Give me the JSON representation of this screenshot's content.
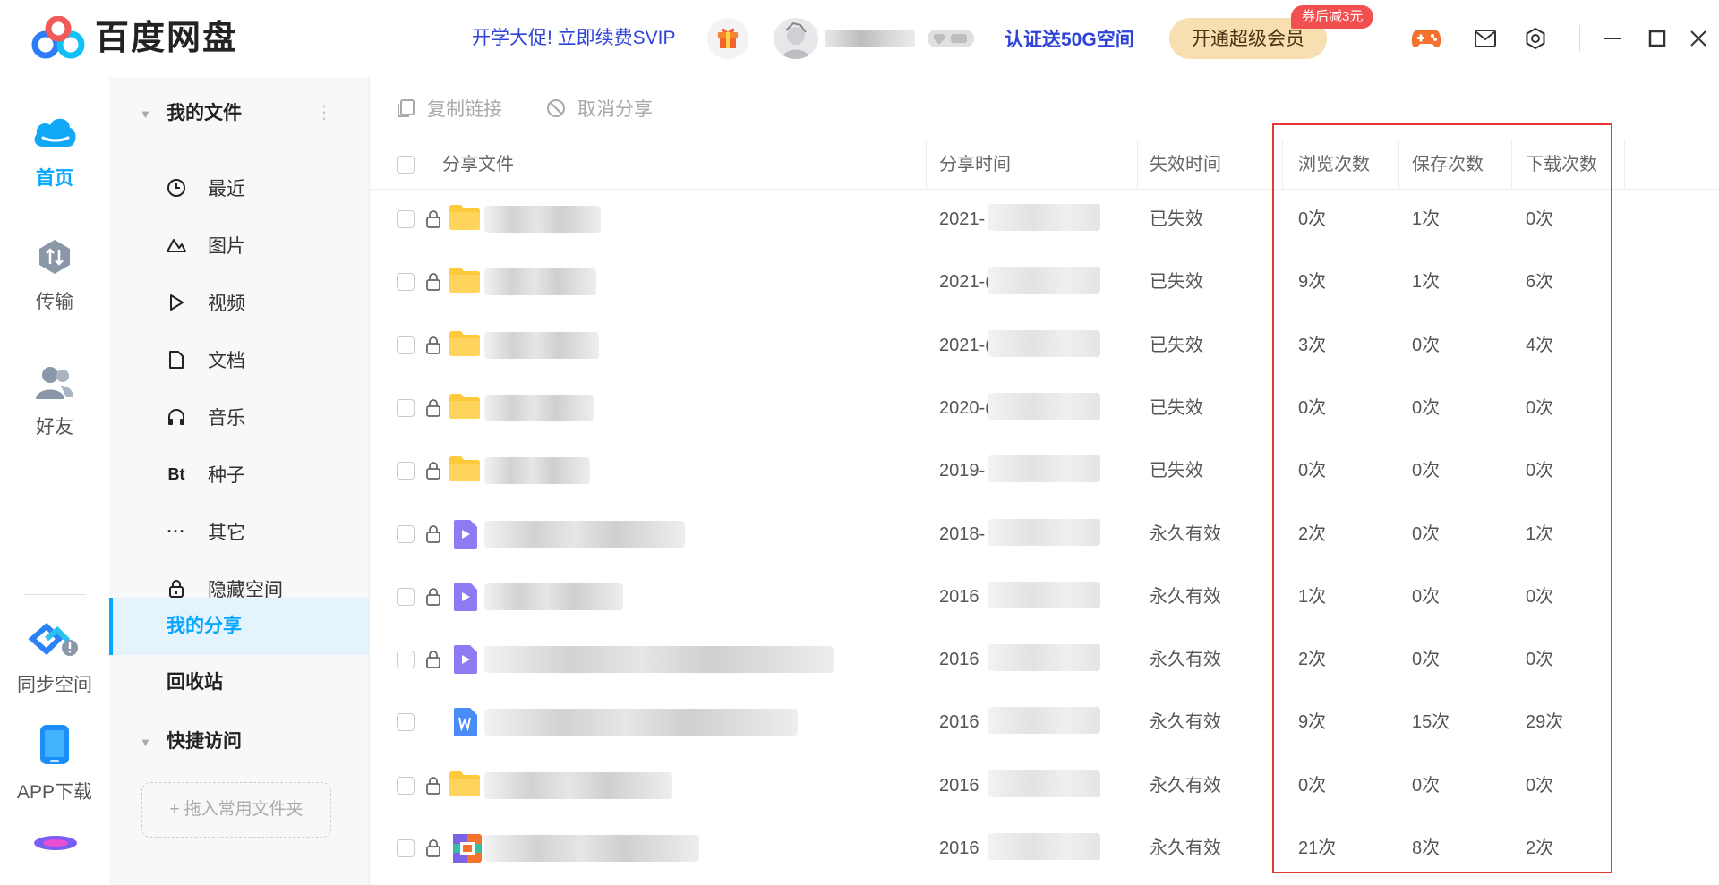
{
  "app": {
    "brand": "百度网盘",
    "promo_text": "开学大促! 立即续费SVIP",
    "verify_text": "认证送50G空间",
    "super_vip_button": "开通超级会员",
    "coupon_badge": "券后减3元"
  },
  "leftnav": {
    "items": [
      {
        "label": "首页",
        "icon": "cloud-icon",
        "active": true
      },
      {
        "label": "传输",
        "icon": "transfer-icon",
        "active": false
      },
      {
        "label": "好友",
        "icon": "friends-icon",
        "active": false
      },
      {
        "label": "同步空间",
        "icon": "sync-space-icon",
        "active": false
      },
      {
        "label": "APP下载",
        "icon": "phone-icon",
        "active": false
      }
    ]
  },
  "sidepanel": {
    "my_files": "我的文件",
    "items": [
      {
        "label": "最近",
        "icon": "clock-icon"
      },
      {
        "label": "图片",
        "icon": "image-icon"
      },
      {
        "label": "视频",
        "icon": "play-icon"
      },
      {
        "label": "文档",
        "icon": "document-icon"
      },
      {
        "label": "音乐",
        "icon": "headphones-icon"
      },
      {
        "label": "种子",
        "icon": "bt-icon"
      },
      {
        "label": "其它",
        "icon": "more-icon"
      },
      {
        "label": "隐藏空间",
        "icon": "lock-icon"
      }
    ],
    "my_share": "我的分享",
    "recycle": "回收站",
    "quick_access": "快捷访问",
    "drop_hint": "+ 拖入常用文件夹"
  },
  "toolbar": {
    "copy_link": "复制链接",
    "cancel_share": "取消分享"
  },
  "table": {
    "columns": [
      "分享文件",
      "分享时间",
      "失效时间",
      "浏览次数",
      "保存次数",
      "下载次数"
    ],
    "rows": [
      {
        "type": "folder",
        "time": "2021-",
        "expire": "已失效",
        "views": "0次",
        "saves": "1次",
        "downloads": "0次"
      },
      {
        "type": "folder",
        "time": "2021-(",
        "expire": "已失效",
        "views": "9次",
        "saves": "1次",
        "downloads": "6次"
      },
      {
        "type": "folder",
        "time": "2021-(",
        "expire": "已失效",
        "views": "3次",
        "saves": "0次",
        "downloads": "4次"
      },
      {
        "type": "folder",
        "time": "2020-(",
        "expire": "已失效",
        "views": "0次",
        "saves": "0次",
        "downloads": "0次"
      },
      {
        "type": "folder",
        "time": "2019-",
        "expire": "已失效",
        "views": "0次",
        "saves": "0次",
        "downloads": "0次"
      },
      {
        "type": "video",
        "time": "2018-",
        "expire": "永久有效",
        "views": "2次",
        "saves": "0次",
        "downloads": "1次"
      },
      {
        "type": "video",
        "time": "2016",
        "expire": "永久有效",
        "views": "1次",
        "saves": "0次",
        "downloads": "0次"
      },
      {
        "type": "video",
        "time": "2016",
        "expire": "永久有效",
        "views": "2次",
        "saves": "0次",
        "downloads": "0次"
      },
      {
        "type": "word",
        "time": "2016",
        "expire": "永久有效",
        "views": "9次",
        "saves": "15次",
        "downloads": "29次"
      },
      {
        "type": "folder",
        "time": "2016",
        "expire": "永久有效",
        "views": "0次",
        "saves": "0次",
        "downloads": "0次"
      },
      {
        "type": "archive",
        "time": "2016",
        "expire": "永久有效",
        "views": "21次",
        "saves": "8次",
        "downloads": "2次"
      }
    ]
  },
  "colors": {
    "accent": "#06a7ff",
    "promo_text": "#2f43d8",
    "highlight_box": "#e53935",
    "folder": "#ffc93c",
    "video": "#8c7bf2",
    "word": "#4a8cf7"
  }
}
